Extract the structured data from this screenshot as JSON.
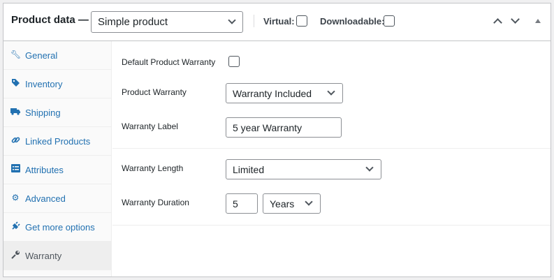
{
  "header": {
    "title": "Product data —",
    "product_type": "Simple product",
    "virtual_label": "Virtual:",
    "virtual_checked": false,
    "downloadable_label": "Downloadable:",
    "downloadable_checked": false,
    "icons": [
      "chevron-up-icon",
      "chevron-down-icon",
      "triangle-up-icon"
    ]
  },
  "sidebar": {
    "items": [
      {
        "label": "General",
        "icon": "wrench-icon",
        "active": false
      },
      {
        "label": "Inventory",
        "icon": "tag-icon",
        "active": false
      },
      {
        "label": "Shipping",
        "icon": "truck-icon",
        "active": false
      },
      {
        "label": "Linked Products",
        "icon": "link-icon",
        "active": false
      },
      {
        "label": "Attributes",
        "icon": "list-icon",
        "active": false
      },
      {
        "label": "Advanced",
        "icon": "gear-icon",
        "active": false
      },
      {
        "label": "Get more options",
        "icon": "plugin-icon",
        "active": false
      },
      {
        "label": "Warranty",
        "icon": "wrench-icon",
        "active": true
      }
    ]
  },
  "warranty": {
    "default_label": "Default Product Warranty",
    "default_checked": false,
    "product_warranty_label": "Product Warranty",
    "product_warranty_value": "Warranty Included",
    "warranty_label_label": "Warranty Label",
    "warranty_label_value": "5 year Warranty",
    "length_label": "Warranty Length",
    "length_value": "Limited",
    "duration_label": "Warranty Duration",
    "duration_number": "5",
    "duration_unit": "Years"
  },
  "colors": {
    "link": "#2271b1",
    "border": "#c3c4c7",
    "active_tab_bg": "#eeeeee"
  }
}
